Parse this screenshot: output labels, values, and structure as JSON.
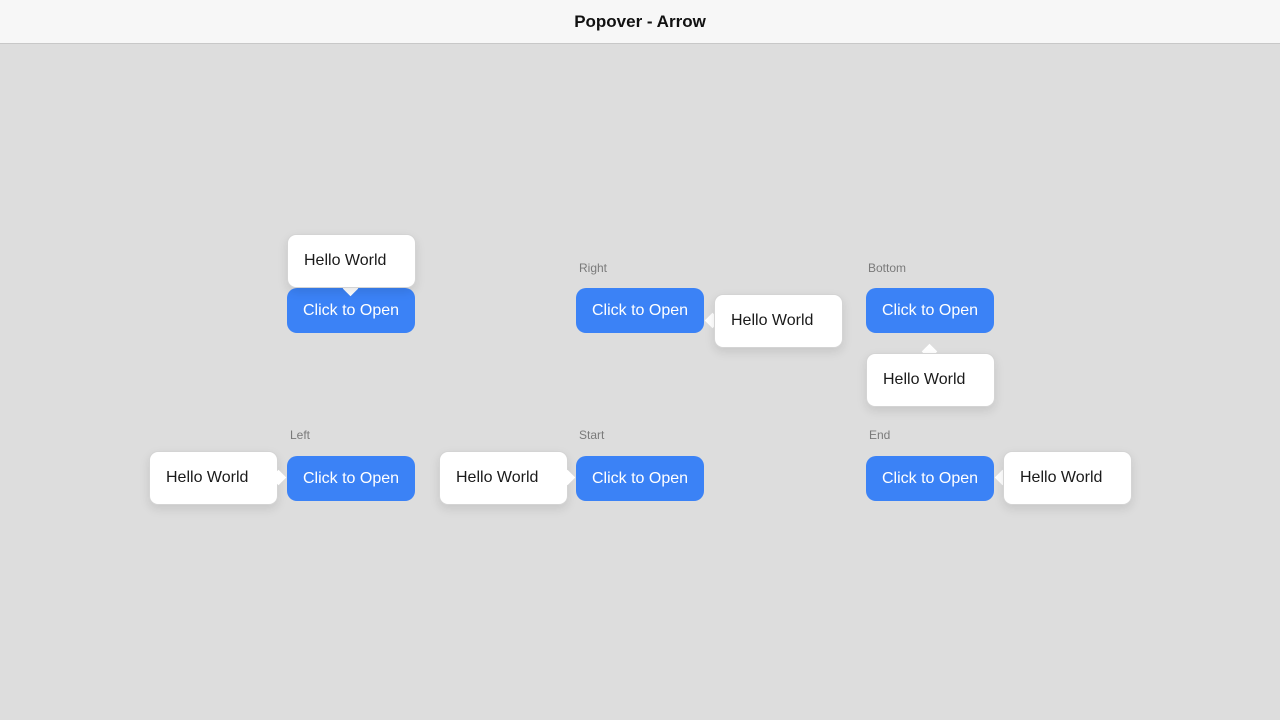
{
  "window": {
    "title": "Popover - Arrow"
  },
  "colors": {
    "button": "#3b82f6",
    "background": "#dddddd",
    "popover": "#ffffff"
  },
  "demos": [
    {
      "label": "",
      "button": "Click to Open",
      "popover": "Hello World"
    },
    {
      "label": "Right",
      "button": "Click to Open",
      "popover": "Hello World"
    },
    {
      "label": "Bottom",
      "button": "Click to Open",
      "popover": "Hello World"
    },
    {
      "label": "Left",
      "button": "Click to Open",
      "popover": "Hello World"
    },
    {
      "label": "Start",
      "button": "Click to Open",
      "popover": "Hello World"
    },
    {
      "label": "End",
      "button": "Click to Open",
      "popover": "Hello World"
    }
  ]
}
